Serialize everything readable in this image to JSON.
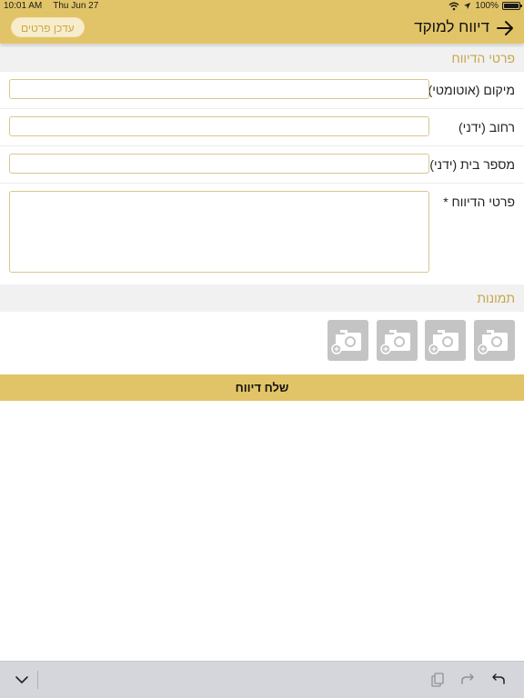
{
  "status_bar": {
    "time": "10:01 AM",
    "date": "Thu Jun 27",
    "battery_percent": "100%",
    "icons": [
      "wifi-icon",
      "location-arrow-icon",
      "battery-icon"
    ]
  },
  "nav": {
    "title": "דיווח למוקד",
    "back_icon": "arrow-right-icon",
    "update_details_label": "עדכן פרטים"
  },
  "report_section": {
    "header": "פרטי הדיווח",
    "fields": [
      {
        "label": "מיקום (אוטומטי)",
        "value": "",
        "placeholder": ""
      },
      {
        "label": "רחוב (ידני)",
        "value": "",
        "placeholder": ""
      },
      {
        "label": "מספר בית (ידני)",
        "value": "",
        "placeholder": ""
      },
      {
        "label": "פרטי הדיווח *",
        "value": "",
        "placeholder": ""
      }
    ]
  },
  "photos_section": {
    "header": "תמונות",
    "slot_icon": "add-photo-camera-icon",
    "slot_count": 4
  },
  "submit_label": "שלח דיווח",
  "keyboard_toolbar": {
    "icons": [
      "chevron-down-icon",
      "clipboard-icon",
      "redo-icon",
      "undo-icon"
    ]
  },
  "colors": {
    "brand_gold": "#e2c468",
    "section_text_gold": "#c7a64a",
    "input_border": "#d8c78f",
    "photo_slot_gray": "#c4c4c4"
  }
}
